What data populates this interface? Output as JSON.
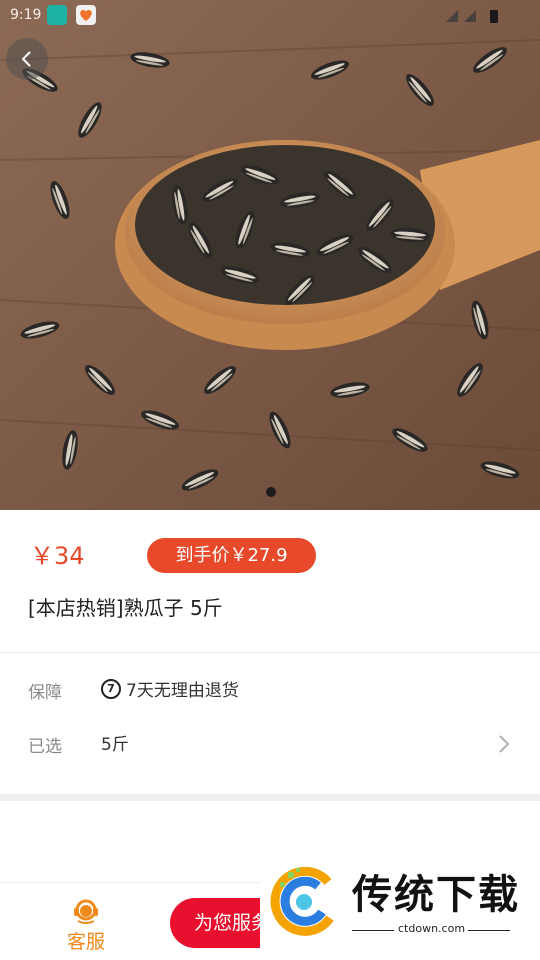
{
  "status_bar": {
    "time": "9:19"
  },
  "product": {
    "price": "￥34",
    "deal_price": "到手价￥27.9",
    "title": "[本店热销]熟瓜子 5斤"
  },
  "rows": {
    "guarantee": {
      "label": "保障",
      "icon_text": "7",
      "value": "7天无理由退货"
    },
    "selected": {
      "label": "已选",
      "value": "5斤"
    }
  },
  "bottom_bar": {
    "service_label": "客服",
    "primary_label": "为您服务"
  },
  "watermark": {
    "title": "传统下载",
    "url": "ctdown.com"
  },
  "colors": {
    "price": "#e8492a",
    "primary": "#e8102e",
    "service": "#f08a1c"
  },
  "carousel": {
    "pages": 1,
    "active": 1
  }
}
